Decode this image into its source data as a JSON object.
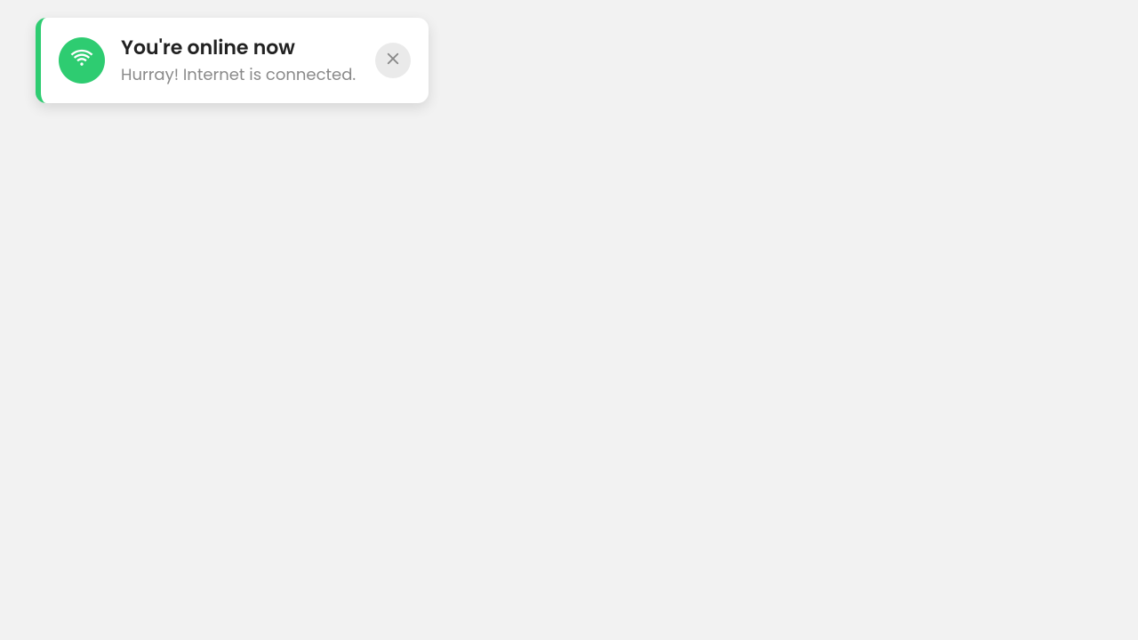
{
  "toast": {
    "title": "You're online now",
    "message": "Hurray! Internet is connected.",
    "accent_color": "#2ecc71",
    "icon": "wifi-icon"
  }
}
